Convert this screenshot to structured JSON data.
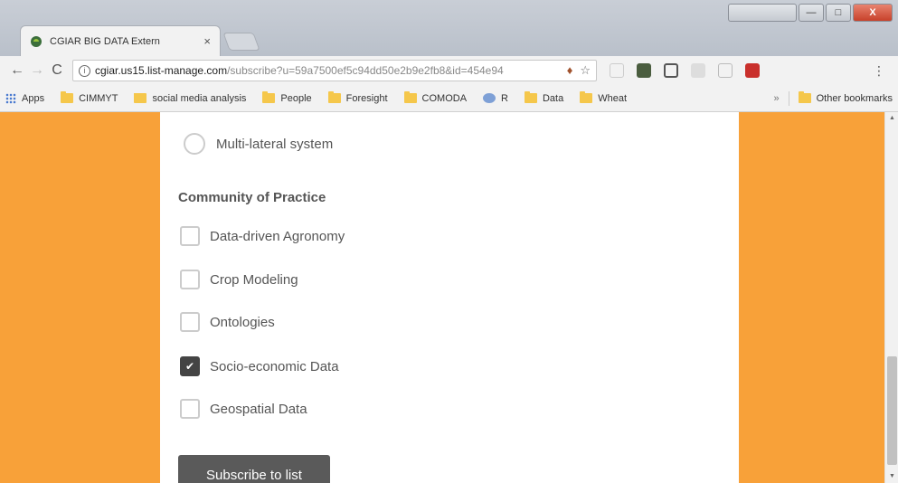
{
  "browser": {
    "tab": {
      "title": "CGIAR BIG DATA Extern",
      "close_glyph": "×"
    },
    "window_controls": {
      "user": "",
      "minimize": "—",
      "maximize": "□",
      "close": "X"
    },
    "url": {
      "host": "cgiar.us15.list-manage.com",
      "path": "/subscribe?u=59a7500ef5c94dd50e2b9e2fb8&id=454e94"
    },
    "nav": {
      "back": "←",
      "forward": "→",
      "reload": "C"
    },
    "bookmarks": [
      {
        "label": "Apps",
        "icon": "apps-grid-icon"
      },
      {
        "label": "CIMMYT",
        "icon": "folder-icon"
      },
      {
        "label": "social media analysis",
        "icon": "folder-icon"
      },
      {
        "label": "People",
        "icon": "folder-icon"
      },
      {
        "label": "Foresight",
        "icon": "folder-icon"
      },
      {
        "label": "COMODA",
        "icon": "folder-icon"
      },
      {
        "label": "R",
        "icon": "r-logo-icon"
      },
      {
        "label": "Data",
        "icon": "folder-icon"
      },
      {
        "label": "Wheat",
        "icon": "folder-icon"
      }
    ],
    "bookmarks_more": "»",
    "other_bookmarks": "Other bookmarks"
  },
  "form": {
    "radio_option": "Multi-lateral system",
    "section_title": "Community of Practice",
    "checkboxes": [
      {
        "label": "Data-driven Agronomy",
        "checked": false
      },
      {
        "label": "Crop Modeling",
        "checked": false
      },
      {
        "label": "Ontologies",
        "checked": false
      },
      {
        "label": "Socio-economic Data",
        "checked": true
      },
      {
        "label": "Geospatial Data",
        "checked": false
      }
    ],
    "submit_label": "Subscribe to list",
    "check_glyph": "✔"
  },
  "colors": {
    "side_panel": "#f8a139",
    "checked_box": "#444444",
    "submit_button": "#5a5a5a"
  }
}
